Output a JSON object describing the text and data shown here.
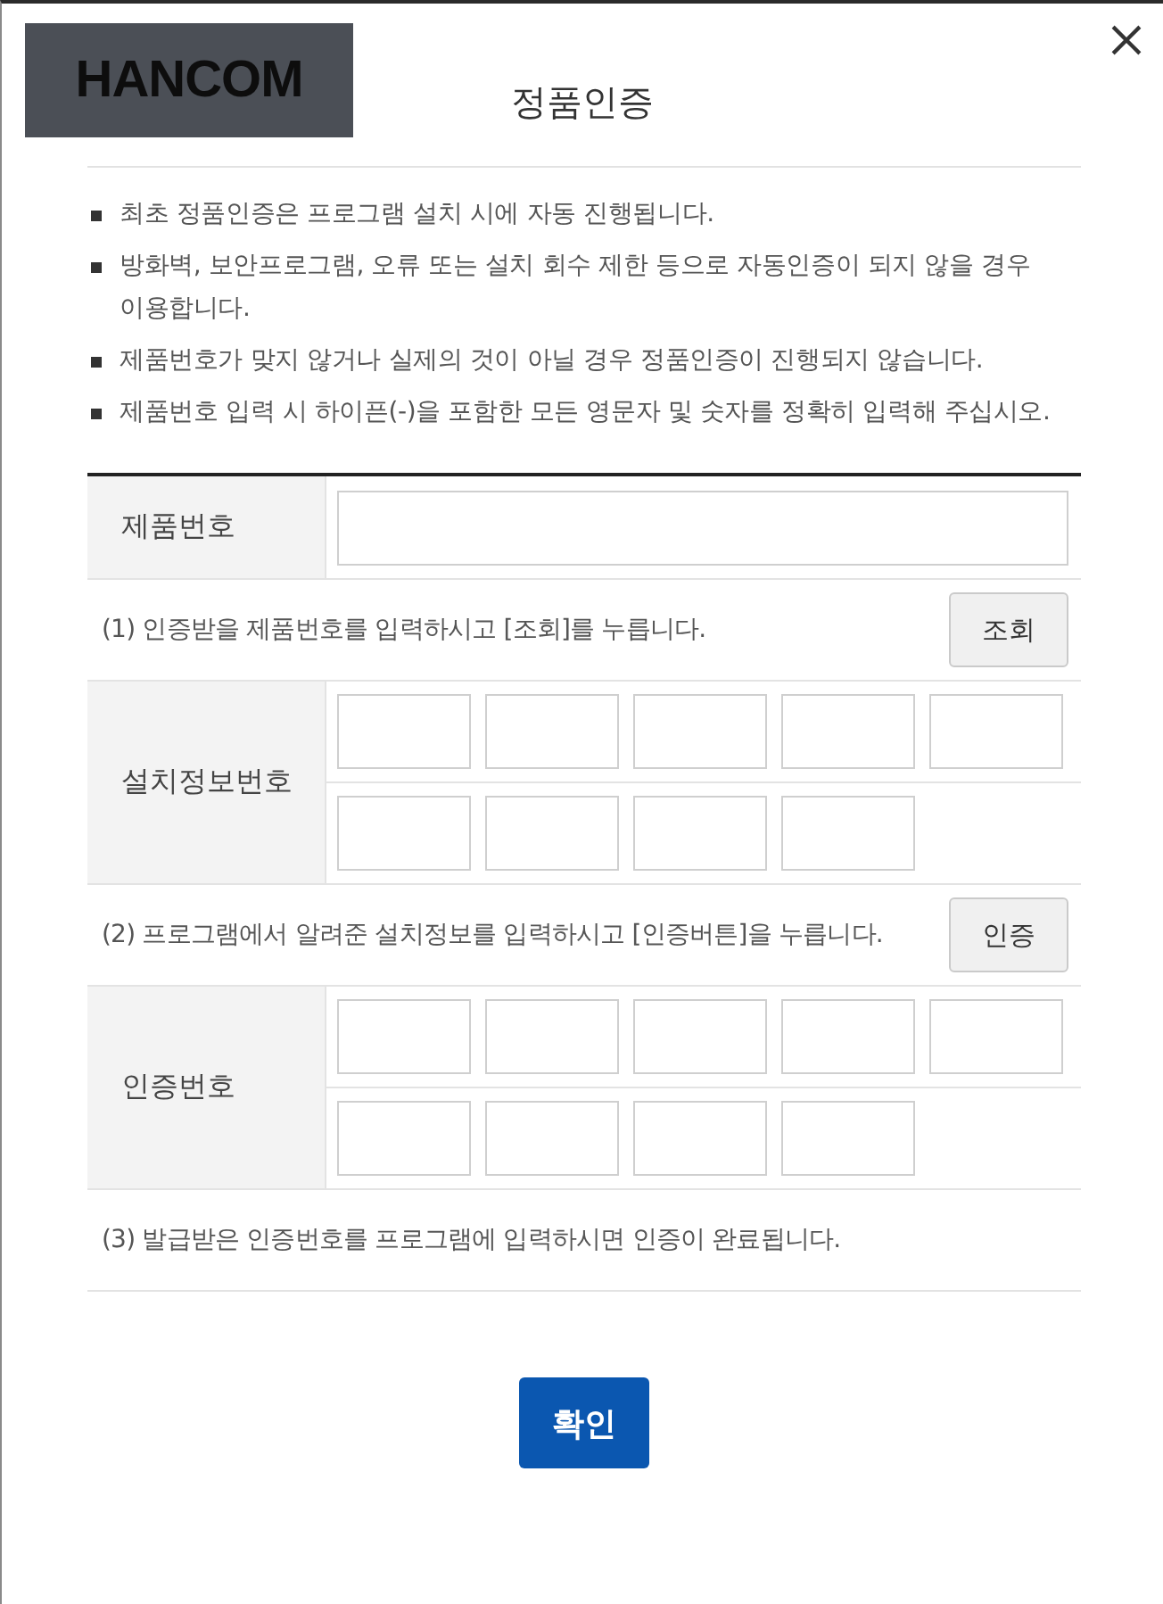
{
  "dialog": {
    "logo": "HANCOM",
    "title": "정품인증"
  },
  "notices": [
    "최초 정품인증은 프로그램 설치 시에 자동 진행됩니다.",
    "방화벽, 보안프로그램, 오류 또는 설치 회수 제한 등으로 자동인증이 되지 않을 경우 이용합니다.",
    "제품번호가 맞지 않거나 실제의 것이 아닐 경우 정품인증이 진행되지 않습니다.",
    "제품번호 입력 시 하이픈(-)을 포함한 모든 영문자 및 숫자를 정확히 입력해 주십시오."
  ],
  "form": [
    {
      "kind": "input",
      "label": "제품번호"
    },
    {
      "kind": "step",
      "text": "(1) 인증받을 제품번호를 입력하시고 [조회]를 누릅니다.",
      "button": "조회"
    },
    {
      "kind": "segments",
      "label": "설치정보번호"
    },
    {
      "kind": "step",
      "text": "(2) 프로그램에서 알려준 설치정보를 입력하시고 [인증버튼]을 누릅니다.",
      "button": "인증"
    },
    {
      "kind": "segments",
      "label": "인증번호"
    },
    {
      "kind": "step",
      "text": "(3) 발급받은 인증번호를 프로그램에 입력하시면 인증이 완료됩니다."
    }
  ],
  "confirm_button": "확인"
}
